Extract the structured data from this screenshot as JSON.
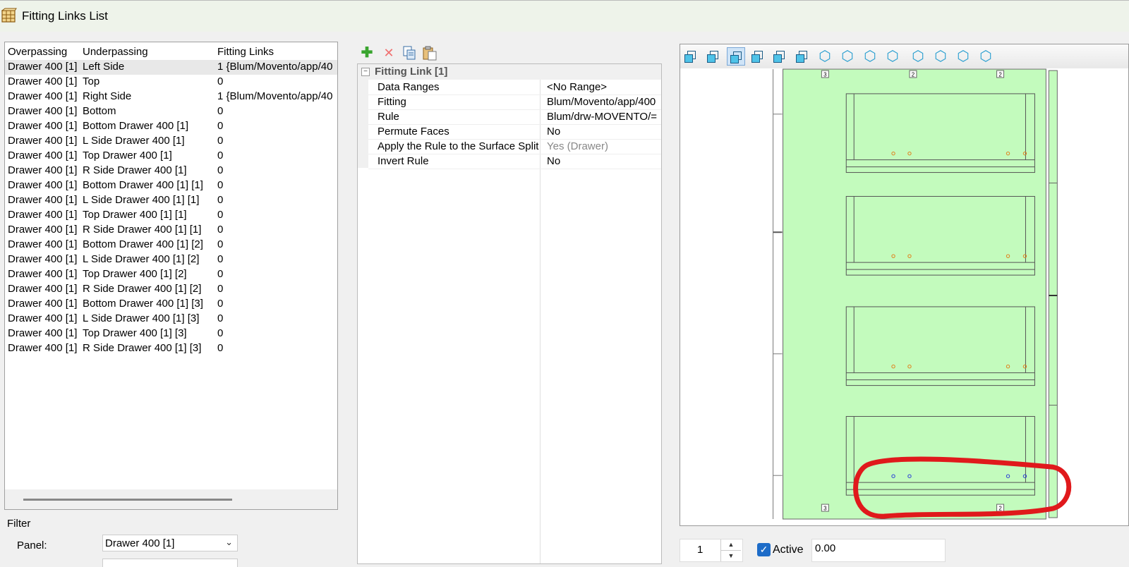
{
  "window": {
    "title": "Fitting Links List",
    "icon": "cabinet-app-icon"
  },
  "list": {
    "headers": [
      "Overpassing",
      "Underpassing",
      "Fitting Links"
    ],
    "rows": [
      [
        "Drawer 400 [1]",
        "Left Side",
        "1 {Blum/Movento/app/40"
      ],
      [
        "Drawer 400 [1]",
        "Top",
        "0"
      ],
      [
        "Drawer 400 [1]",
        "Right Side",
        "1 {Blum/Movento/app/40"
      ],
      [
        "Drawer 400 [1]",
        "Bottom",
        "0"
      ],
      [
        "Drawer 400 [1]",
        "Bottom Drawer 400 [1]",
        "0"
      ],
      [
        "Drawer 400 [1]",
        "L Side Drawer 400 [1]",
        "0"
      ],
      [
        "Drawer 400 [1]",
        "Top Drawer 400 [1]",
        "0"
      ],
      [
        "Drawer 400 [1]",
        "R Side Drawer 400 [1]",
        "0"
      ],
      [
        "Drawer 400 [1]",
        "Bottom Drawer 400 [1] [1]",
        "0"
      ],
      [
        "Drawer 400 [1]",
        "L Side Drawer 400 [1] [1]",
        "0"
      ],
      [
        "Drawer 400 [1]",
        "Top Drawer 400 [1] [1]",
        "0"
      ],
      [
        "Drawer 400 [1]",
        "R Side Drawer 400 [1] [1]",
        "0"
      ],
      [
        "Drawer 400 [1]",
        "Bottom Drawer 400 [1] [2]",
        "0"
      ],
      [
        "Drawer 400 [1]",
        "L Side Drawer 400 [1] [2]",
        "0"
      ],
      [
        "Drawer 400 [1]",
        "Top Drawer 400 [1] [2]",
        "0"
      ],
      [
        "Drawer 400 [1]",
        "R Side Drawer 400 [1] [2]",
        "0"
      ],
      [
        "Drawer 400 [1]",
        "Bottom Drawer 400 [1] [3]",
        "0"
      ],
      [
        "Drawer 400 [1]",
        "L Side Drawer 400 [1] [3]",
        "0"
      ],
      [
        "Drawer 400 [1]",
        "Top Drawer 400 [1] [3]",
        "0"
      ],
      [
        "Drawer 400 [1]",
        "R Side Drawer 400 [1] [3]",
        "0"
      ]
    ],
    "selected_row": 0
  },
  "filter": {
    "title": "Filter",
    "panel_label": "Panel:",
    "panel_value": "Drawer 400 [1]"
  },
  "toolbar": {
    "icons": [
      "add-icon",
      "delete-icon",
      "copy-icon",
      "paste-icon"
    ]
  },
  "properties": {
    "group": "Fitting Link [1]",
    "rows": [
      {
        "name": "Data Ranges",
        "value": "<No Range>",
        "muted": false
      },
      {
        "name": "Fitting",
        "value": "Blum/Movento/app/400",
        "muted": false
      },
      {
        "name": "Rule",
        "value": "Blum/drw-MOVENTO/=",
        "muted": false
      },
      {
        "name": "Permute Faces",
        "value": "No",
        "muted": false
      },
      {
        "name": "Apply the Rule to the Surface Split",
        "value": "Yes (Drawer)",
        "muted": true
      },
      {
        "name": "Invert Rule",
        "value": "No",
        "muted": false
      }
    ]
  },
  "viewer": {
    "view_icons": [
      "front-view-icon",
      "back-view-icon",
      "left-view-icon",
      "right-view-icon",
      "top-view-icon",
      "bottom-view-icon",
      "iso-view-1-icon",
      "iso-view-2-icon",
      "iso-view-3-icon",
      "iso-view-4-icon",
      "iso-view-5-icon",
      "iso-view-6-icon",
      "iso-view-7-icon",
      "iso-view-8-icon"
    ],
    "selected_view": 2,
    "dimension_tags": [
      "3",
      "2",
      "2",
      "3",
      "2"
    ],
    "panel_color": "#c3fbbd",
    "highlight_color": "#e0191c"
  },
  "bottom": {
    "counter": "1",
    "active_label": "Active",
    "active_checked": true,
    "value": "0.00"
  }
}
